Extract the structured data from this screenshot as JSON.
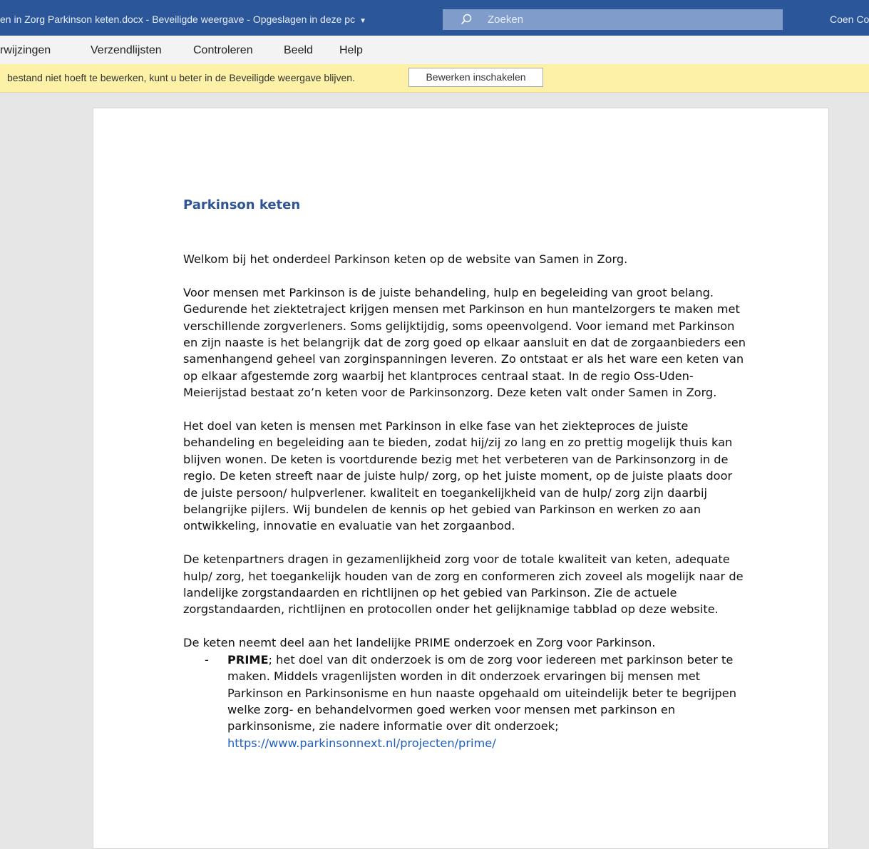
{
  "titlebar": {
    "doc_title": "en in Zorg Parkinson keten.docx  -  Beveiligde weergave  -  Opgeslagen in deze pc",
    "search_label": "Zoeken",
    "user": "Coen Co"
  },
  "ribbon": {
    "tabs": [
      "rwijzingen",
      "Verzendlijsten",
      "Controleren",
      "Beeld",
      "Help"
    ]
  },
  "infobar": {
    "message": "bestand niet hoeft te bewerken, kunt u beter in de Beveiligde weergave blijven.",
    "button": "Bewerken inschakelen"
  },
  "document": {
    "heading": "Parkinson keten",
    "paragraphs": [
      "Welkom bij het onderdeel Parkinson keten op de website van Samen in Zorg.",
      "Voor mensen met Parkinson is de juiste behandeling, hulp en begeleiding  van groot belang. Gedurende het ziektetraject krijgen mensen met Parkinson en hun mantelzorgers te maken met verschillende zorgverleners. Soms gelijktijdig, soms opeenvolgend. Voor iemand met Parkinson en zijn naaste is het belangrijk dat de zorg goed op elkaar aansluit en dat de zorgaanbieders een samenhangend geheel van zorginspanningen leveren. Zo ontstaat er als het ware een keten van op elkaar afgestemde zorg waarbij het klantproces centraal staat. In de regio Oss-Uden-Meierijstad bestaat zo’n keten voor de Parkinsonzorg. Deze keten valt onder Samen in Zorg.",
      "Het doel van keten is mensen met Parkinson in elke fase van het ziekteproces de juiste behandeling en begeleiding aan te bieden, zodat hij/zij zo lang en zo prettig mogelijk thuis kan blijven wonen. De keten is voortdurende bezig met het verbeteren van de Parkinsonzorg in de regio. De keten streeft naar de juiste hulp/ zorg, op het juiste moment, op de juiste plaats door de juiste persoon/ hulpverlener. kwaliteit en toegankelijkheid van de hulp/ zorg zijn daarbij belangrijke pijlers. Wij bundelen de kennis op het gebied van Parkinson en werken zo aan ontwikkeling, innovatie en evaluatie van het zorgaanbod.",
      "De ketenpartners dragen in gezamenlijkheid zorg voor de totale kwaliteit van keten, adequate hulp/ zorg, het toegankelijk houden van de zorg en conformeren zich zoveel als mogelijk naar de landelijke zorgstandaarden en richtlijnen op het gebied van Parkinson. Zie de actuele zorgstandaarden, richtlijnen en protocollen onder het gelijknamige tabblad op deze website.",
      "De keten neemt deel aan het landelijke PRIME onderzoek en Zorg voor Parkinson."
    ],
    "bullet": {
      "dash": "-",
      "bold": "PRIME",
      "text": "; het doel van dit onderzoek is om de zorg voor iedereen met parkinson beter te maken. Middels vragenlijsten worden in dit onderzoek ervaringen bij mensen met Parkinson en Parkinsonisme en hun naaste opgehaald om uiteindelijk beter te begrijpen welke zorg- en behandelvormen goed werken voor mensen met parkinson en parkinsonisme, zie nadere informatie over dit onderzoek;",
      "link": "https://www.parkinsonnext.nl/projecten/prime/"
    }
  }
}
